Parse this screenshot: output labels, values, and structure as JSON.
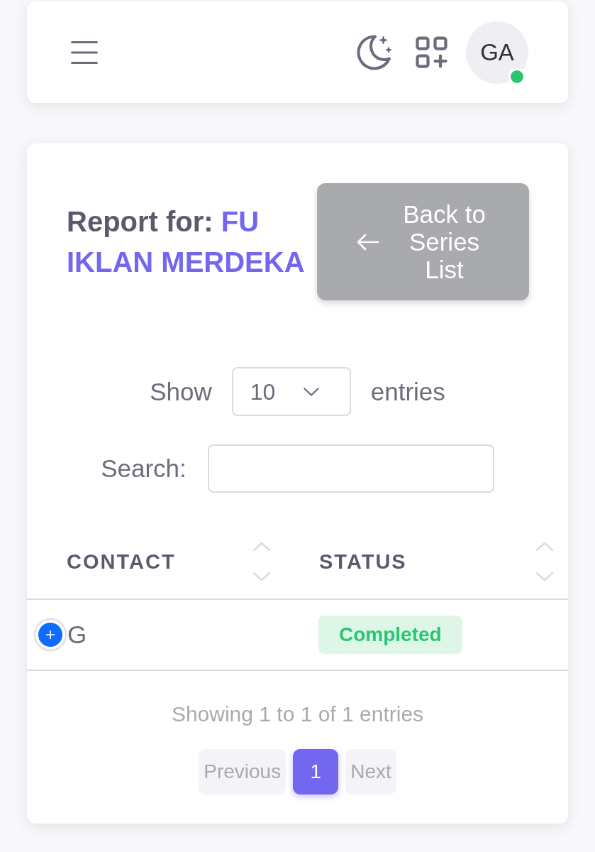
{
  "navbar": {
    "avatar": {
      "initials": "GA",
      "online": true
    }
  },
  "header": {
    "title_label": "Report for:",
    "title_value": "FU IKLAN MERDEKA",
    "back_button": "Back to Series List"
  },
  "length_menu": {
    "label_before": "Show",
    "value": "10",
    "label_after": "entries"
  },
  "search": {
    "label": "Search:"
  },
  "table": {
    "columns": [
      {
        "label": "CONTACT"
      },
      {
        "label": "STATUS"
      }
    ],
    "rows": [
      {
        "expanded": false,
        "contact": "G",
        "status": "Completed",
        "color": "#28c76f"
      }
    ]
  },
  "info": "Showing 1 to 1 of 1 entries",
  "pagination": [
    {
      "label": "Previous",
      "selected": false,
      "disabled": true
    },
    {
      "label": "1",
      "selected": true,
      "disabled": false
    },
    {
      "label": "Next",
      "selected": false,
      "disabled": true
    }
  ]
}
